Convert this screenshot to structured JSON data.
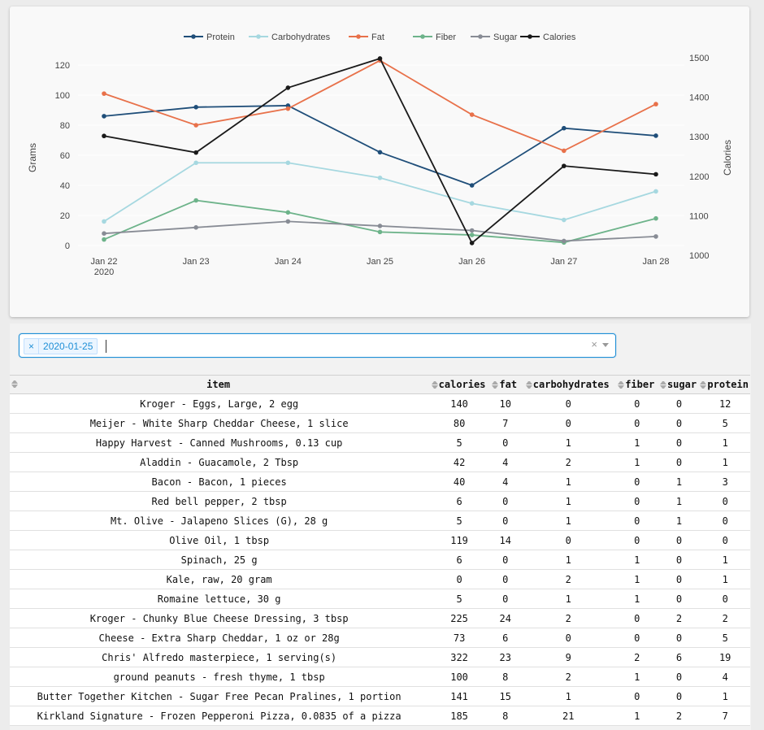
{
  "chart_data": {
    "type": "line",
    "x": [
      "Jan 22",
      "Jan 23",
      "Jan 24",
      "Jan 25",
      "Jan 26",
      "Jan 27",
      "Jan 28"
    ],
    "x_year": "2020",
    "ylabel": "Grams",
    "y2label": "Calories",
    "ylim": [
      0,
      125
    ],
    "y2lim": [
      1000,
      1500
    ],
    "yticks": [
      0,
      20,
      40,
      60,
      80,
      100,
      120
    ],
    "y2ticks": [
      1000,
      1100,
      1200,
      1300,
      1400,
      1500
    ],
    "legend_position": "top",
    "series": [
      {
        "name": "Protein",
        "axis": "y",
        "color": "#1f4e79",
        "values": [
          86,
          92,
          93,
          62,
          40,
          78,
          73
        ]
      },
      {
        "name": "Carbohydrates",
        "axis": "y",
        "color": "#a6d8e0",
        "values": [
          16,
          55,
          55,
          45,
          28,
          17,
          36
        ]
      },
      {
        "name": "Fat",
        "axis": "y",
        "color": "#e8714a",
        "values": [
          101,
          80,
          91,
          123,
          87,
          63,
          94
        ]
      },
      {
        "name": "Fiber",
        "axis": "y",
        "color": "#6db38a",
        "values": [
          4,
          30,
          22,
          9,
          7,
          2,
          18
        ]
      },
      {
        "name": "Sugar",
        "axis": "y",
        "color": "#888c95",
        "values": [
          8,
          12,
          16,
          13,
          10,
          3,
          6
        ]
      },
      {
        "name": "Calories",
        "axis": "y2",
        "color": "#1a1a1a",
        "values": [
          1302,
          1260,
          1424,
          1498,
          1031,
          1226,
          1205
        ]
      }
    ]
  },
  "filter": {
    "tag": "2020-01-25",
    "remove_symbol": "×",
    "clear_symbol": "×"
  },
  "table": {
    "columns": [
      "item",
      "calories",
      "fat",
      "carbohydrates",
      "fiber",
      "sugar",
      "protein"
    ],
    "rows": [
      [
        "Kroger - Eggs, Large, 2 egg",
        "140",
        "10",
        "0",
        "0",
        "0",
        "12"
      ],
      [
        "Meijer - White Sharp Cheddar Cheese, 1 slice",
        "80",
        "7",
        "0",
        "0",
        "0",
        "5"
      ],
      [
        "Happy Harvest - Canned Mushrooms, 0.13 cup",
        "5",
        "0",
        "1",
        "1",
        "0",
        "1"
      ],
      [
        "Aladdin - Guacamole, 2 Tbsp",
        "42",
        "4",
        "2",
        "1",
        "0",
        "1"
      ],
      [
        "Bacon - Bacon, 1 pieces",
        "40",
        "4",
        "1",
        "0",
        "1",
        "3"
      ],
      [
        "Red bell pepper, 2 tbsp",
        "6",
        "0",
        "1",
        "0",
        "1",
        "0"
      ],
      [
        "Mt. Olive - Jalapeno Slices (G), 28 g",
        "5",
        "0",
        "1",
        "0",
        "1",
        "0"
      ],
      [
        "Olive Oil, 1 tbsp",
        "119",
        "14",
        "0",
        "0",
        "0",
        "0"
      ],
      [
        "Spinach, 25 g",
        "6",
        "0",
        "1",
        "1",
        "0",
        "1"
      ],
      [
        "Kale, raw, 20 gram",
        "0",
        "0",
        "2",
        "1",
        "0",
        "1"
      ],
      [
        "Romaine lettuce, 30 g",
        "5",
        "0",
        "1",
        "1",
        "0",
        "0"
      ],
      [
        "Kroger - Chunky Blue Cheese Dressing, 3 tbsp",
        "225",
        "24",
        "2",
        "0",
        "2",
        "2"
      ],
      [
        "Cheese - Extra Sharp Cheddar, 1 oz or 28g",
        "73",
        "6",
        "0",
        "0",
        "0",
        "5"
      ],
      [
        "Chris' Alfredo masterpiece, 1 serving(s)",
        "322",
        "23",
        "9",
        "2",
        "6",
        "19"
      ],
      [
        "ground peanuts - fresh thyme, 1 tbsp",
        "100",
        "8",
        "2",
        "1",
        "0",
        "4"
      ],
      [
        "Butter Together Kitchen - Sugar Free Pecan Pralines, 1 portion",
        "141",
        "15",
        "1",
        "0",
        "0",
        "1"
      ],
      [
        "Kirkland Signature - Frozen Pepperoni Pizza, 0.0835 of a pizza",
        "185",
        "8",
        "21",
        "1",
        "2",
        "7"
      ]
    ]
  }
}
